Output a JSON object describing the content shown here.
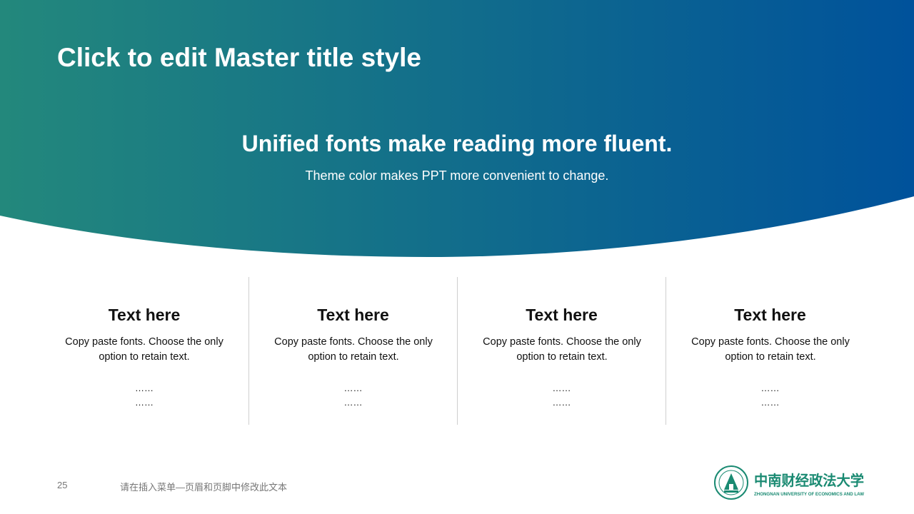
{
  "slide": {
    "master_title": "Click to edit Master title style",
    "headline": "Unified fonts make reading more fluent.",
    "subline": "Theme color makes PPT more convenient to change."
  },
  "columns": [
    {
      "title": "Text here",
      "body": "Copy paste fonts. Choose the only option to retain text.",
      "dots1": "……",
      "dots2": "……"
    },
    {
      "title": "Text here",
      "body": "Copy paste fonts. Choose the only option to retain text.",
      "dots1": "……",
      "dots2": "……"
    },
    {
      "title": "Text here",
      "body": "Copy paste fonts. Choose the only option to retain text.",
      "dots1": "……",
      "dots2": "……"
    },
    {
      "title": "Text here",
      "body": "Copy paste fonts. Choose the only option to retain text.",
      "dots1": "……",
      "dots2": "……"
    }
  ],
  "footer": {
    "page_number": "25",
    "text": "请在插入菜单—页眉和页脚中修改此文本"
  },
  "logo": {
    "name_cn": "中南财经政法大学",
    "name_en": "ZHONGNAN UNIVERSITY OF ECONOMICS AND LAW"
  },
  "colors": {
    "gradient_start": "#23887c",
    "gradient_end": "#00529b",
    "logo_green": "#1a8a72"
  }
}
